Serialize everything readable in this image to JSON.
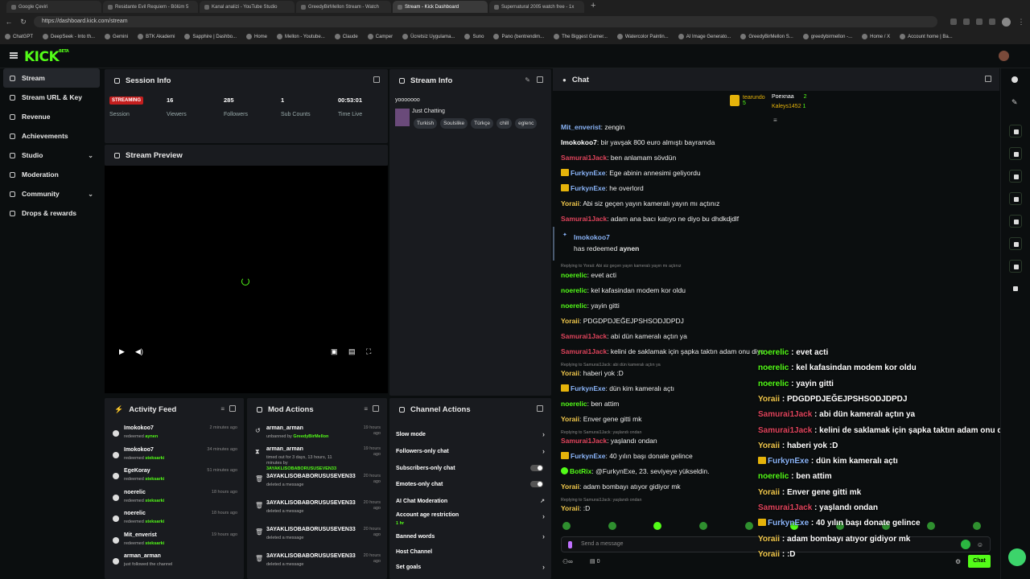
{
  "browser": {
    "tabs": [
      {
        "label": "Google Çeviri",
        "active": false
      },
      {
        "label": "Residante Evil Requiem - Bölüm 5",
        "active": false
      },
      {
        "label": "Kanal analizi - YouTube Studio",
        "active": false
      },
      {
        "label": "GreedyBirMellon Stream - Watch",
        "active": false
      },
      {
        "label": "Stream - Kick Dashboard",
        "active": true
      },
      {
        "label": "Supernatural 2005 watch free - 1x",
        "active": false
      }
    ],
    "url": "https://dashboard.kick.com/stream",
    "bookmarks": [
      "ChatGPT",
      "DeepSeek - Into th...",
      "Gemini",
      "BTK Akademi",
      "Sapphire | Dashbo...",
      "Home",
      "Mellon - Youtube...",
      "Claude",
      "Camper",
      "Ücretsiz Uygulama...",
      "Suno",
      "Pano (bentrendim...",
      "The Biggest Gamer...",
      "Watercolor Paintin...",
      "AI Image Generato...",
      "GreedyBirMellon S...",
      "greedybirmellon -...",
      "Home / X",
      "Account home | Ba..."
    ]
  },
  "brand": {
    "logo": "KICK",
    "beta": "BETA",
    "accent": "#53fc18"
  },
  "sidebar": {
    "items": [
      {
        "label": "Stream",
        "active": true,
        "icon": "stream-icon"
      },
      {
        "label": "Stream URL & Key",
        "icon": "key-icon"
      },
      {
        "label": "Revenue",
        "icon": "dollar-icon"
      },
      {
        "label": "Achievements",
        "icon": "trophy-icon"
      },
      {
        "label": "Studio",
        "icon": "studio-icon",
        "expand": true
      },
      {
        "label": "Moderation",
        "icon": "hammer-icon"
      },
      {
        "label": "Community",
        "icon": "community-icon",
        "expand": true
      },
      {
        "label": "Drops & rewards",
        "icon": "gift-icon"
      }
    ]
  },
  "session": {
    "title": "Session Info",
    "status": "STREAMING",
    "session_label": "Session",
    "stats": [
      {
        "value": "16",
        "label": "Viewers"
      },
      {
        "value": "285",
        "label": "Followers"
      },
      {
        "value": "1",
        "label": "Sub Counts"
      },
      {
        "value": "00:53:01",
        "label": "Time Live"
      }
    ]
  },
  "preview": {
    "title": "Stream Preview"
  },
  "streaminfo": {
    "title": "Stream Info",
    "stream_title": "yooooooo",
    "category": "Just Chatting",
    "tags": [
      "Turkish",
      "Soulslike",
      "Türkçe",
      "chill",
      "eglenc"
    ]
  },
  "activity": {
    "title": "Activity Feed",
    "items": [
      {
        "name": "Imokokoo7",
        "action": "redeemed",
        "target": "aynen",
        "time": "2 minutes ago"
      },
      {
        "name": "Imokokoo7",
        "action": "redeemed",
        "target": "steksarki",
        "time": "34 minutes ago"
      },
      {
        "name": "EgeKoray",
        "action": "redeemed",
        "target": "steksarki",
        "time": "51 minutes ago"
      },
      {
        "name": "noerelic",
        "action": "redeemed",
        "target": "steksarki",
        "time": "18 hours ago"
      },
      {
        "name": "noerelic",
        "action": "redeemed",
        "target": "steksarki",
        "time": "18 hours ago"
      },
      {
        "name": "Mit_enverist",
        "action": "redeemed",
        "target": "steksarki",
        "time": "19 hours ago"
      },
      {
        "name": "arman_arman",
        "action": "just followed the channel",
        "target": "",
        "time": ""
      }
    ]
  },
  "mod": {
    "title": "Mod Actions",
    "items": [
      {
        "name": "arman_arman",
        "desc": "unbanned by",
        "by": "GreedyBirMellon",
        "time": "19 hours ago"
      },
      {
        "name": "arman_arman",
        "desc": "timed out for 3 days, 13 hours, 11 minutes by",
        "by": "3AYAKLISOBABORUSUSEVEN33",
        "time": "19 hours ago"
      },
      {
        "name": "3AYAKLISOBABORUSUSEVEN33",
        "desc": "deleted a message",
        "by": "",
        "time": "20 hours ago"
      },
      {
        "name": "3AYAKLISOBABORUSUSEVEN33",
        "desc": "deleted a message",
        "by": "",
        "time": "20 hours ago"
      },
      {
        "name": "3AYAKLISOBABORUSUSEVEN33",
        "desc": "deleted a message",
        "by": "",
        "time": "20 hours ago"
      },
      {
        "name": "3AYAKLISOBABORUSUSEVEN33",
        "desc": "deleted a message",
        "by": "",
        "time": "20 hours ago"
      }
    ]
  },
  "channel": {
    "title": "Channel Actions",
    "items": [
      {
        "label": "Slow mode",
        "kind": "arrow"
      },
      {
        "label": "Followers-only chat",
        "kind": "arrow"
      },
      {
        "label": "Subscribers-only chat",
        "kind": "toggle"
      },
      {
        "label": "Emotes-only chat",
        "kind": "toggle"
      },
      {
        "label": "AI Chat Moderation",
        "kind": "link"
      },
      {
        "label": "Account age restriction",
        "kind": "arrow",
        "sub": "1 hr"
      },
      {
        "label": "Banned words",
        "kind": "arrow"
      },
      {
        "label": "Host Channel",
        "kind": "none"
      },
      {
        "label": "Set goals",
        "kind": "arrow"
      }
    ]
  },
  "chat": {
    "title": "Chat",
    "leaderboard": [
      {
        "name": "tearundo",
        "count": "5"
      },
      {
        "name": "Poexnaa",
        "count": "2"
      },
      {
        "name": "Kaleys1452",
        "count": "1"
      }
    ],
    "messages": [
      {
        "user": "Mit_enverist",
        "color": "#8ab4f8",
        "text": "zengin"
      },
      {
        "user": "Imokokoo7",
        "color": "#ffffff",
        "text": "bir yavşak 800 euro almıştı bayramda"
      },
      {
        "user": "Samurai1Jack",
        "color": "#e0445c",
        "text": "ben anlamam sövdün"
      },
      {
        "user": "FurkynExe",
        "color": "#8ab4f8",
        "text": "Ege abinin annesimi geliyordu",
        "crown": true
      },
      {
        "user": "FurkynExe",
        "color": "#8ab4f8",
        "text": "he overlord",
        "crown": true
      },
      {
        "user": "Yoraii",
        "color": "#f2c94c",
        "text": "Abi siz geçen yayın kameralı yayın mı açtınız"
      },
      {
        "user": "Samurai1Jack",
        "color": "#e0445c",
        "text": "adam ana bacı katıyo ne diyo bu dhdkdjdlf"
      }
    ],
    "redeem": {
      "user": "Imokokoo7",
      "text": "has redeemed",
      "reward": "aynen"
    },
    "reply1": "Replying to Yoraii: Abi siz geçen yayın kameralı yayın mı açtınız",
    "messages2": [
      {
        "user": "noerelic",
        "color": "#53fc18",
        "text": "evet acti"
      },
      {
        "user": "noerelic",
        "color": "#53fc18",
        "text": "kel kafasindan modem kor oldu"
      },
      {
        "user": "noerelic",
        "color": "#53fc18",
        "text": "yayin gitti"
      },
      {
        "user": "Yoraii",
        "color": "#f2c94c",
        "text": "PDGDPDJEĞEJPSHSODJDPDJ"
      },
      {
        "user": "Samurai1Jack",
        "color": "#e0445c",
        "text": "abi dün kameralı açtın ya"
      },
      {
        "user": "Samurai1Jack",
        "color": "#e0445c",
        "text": "kelini de saklamak için şapka taktın adam onu diyo"
      }
    ],
    "reply2": "Replying to Samurai1Jack: abi dün kameralı açtın ya",
    "messages3": [
      {
        "user": "Yoraii",
        "color": "#f2c94c",
        "text": "haberi yok :D"
      },
      {
        "user": "FurkynExe",
        "color": "#8ab4f8",
        "text": "dün kim kameralı açtı",
        "crown": true
      },
      {
        "user": "noerelic",
        "color": "#53fc18",
        "text": "ben attim"
      },
      {
        "user": "Yoraii",
        "color": "#f2c94c",
        "text": "Enver gene gitti mk"
      }
    ],
    "reply3": "Replying to Samurai1Jack: yaşlandı ondan",
    "messages4": [
      {
        "user": "Samurai1Jack",
        "color": "#e0445c",
        "text": "yaşlandı ondan"
      },
      {
        "user": "FurkynExe",
        "color": "#8ab4f8",
        "text": "40 yılın başı donate gelince",
        "crown": true
      },
      {
        "user": "BotRix",
        "color": "#53fc18",
        "text": "@FurkynExe, 23. seviyeye yükseldin.",
        "bot": true
      },
      {
        "user": "Yoraii",
        "color": "#f2c94c",
        "text": "adam bombayı atıyor gidiyor mk"
      }
    ],
    "reply4": "Replying to Samurai1Jack: yaşlandı ondan",
    "last": {
      "user": "Yoraii",
      "color": "#f2c94c",
      "text": ":D"
    },
    "input_placeholder": "Send a message",
    "viewers_count": "0",
    "send_label": "Chat"
  },
  "overlay": [
    {
      "user": "noerelic",
      "color": "#53fc18",
      "text": "evet acti"
    },
    {
      "user": "noerelic",
      "color": "#53fc18",
      "text": "kel kafasindan modem kor oldu"
    },
    {
      "user": "noerelic",
      "color": "#53fc18",
      "text": "yayin gitti"
    },
    {
      "user": "Yoraii",
      "color": "#f2c94c",
      "text": "PDGDPDJEĞEJPSHSODJDPDJ"
    },
    {
      "user": "Samurai1Jack",
      "color": "#e0445c",
      "text": "abi dün kameralı açtın ya"
    },
    {
      "user": "Samurai1Jack",
      "color": "#e0445c",
      "text": "kelini de saklamak için şapka taktın adam onu diyo"
    },
    {
      "user": "Yoraii",
      "color": "#f2c94c",
      "text": "haberi yok :D"
    },
    {
      "user": "FurkynExe",
      "color": "#8ab4f8",
      "text": "dün kim kameralı açtı",
      "crown": true
    },
    {
      "user": "noerelic",
      "color": "#53fc18",
      "text": "ben attim"
    },
    {
      "user": "Yoraii",
      "color": "#f2c94c",
      "text": "Enver gene gitti mk"
    },
    {
      "user": "Samurai1Jack",
      "color": "#e0445c",
      "text": "yaşlandı ondan"
    },
    {
      "user": "FurkynExe",
      "color": "#8ab4f8",
      "text": "40 yılın başı donate gelince",
      "crown": true
    },
    {
      "user": "Yoraii",
      "color": "#f2c94c",
      "text": "adam bombayı atıyor gidiyor mk"
    },
    {
      "user": "Yoraii",
      "color": "#f2c94c",
      "text": ":D"
    }
  ]
}
